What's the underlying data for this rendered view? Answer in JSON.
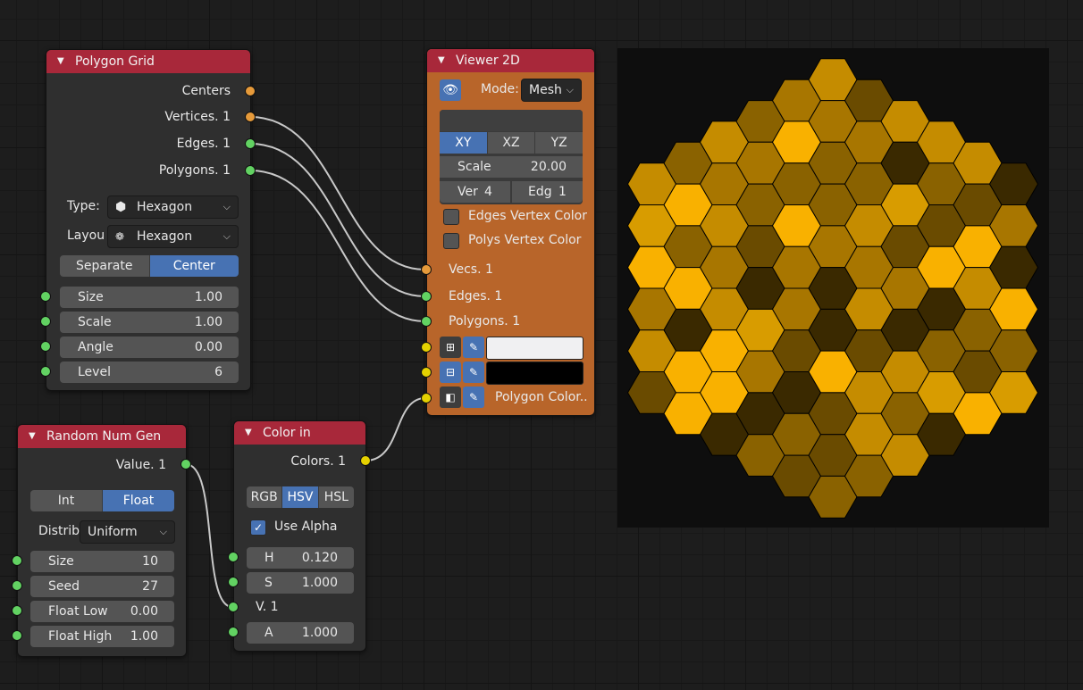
{
  "colors": {
    "node_bg": "#2f2f2f",
    "header_red": "#a8283a",
    "viewer_orange": "#b8652a",
    "accent_blue": "#4772b3",
    "socket_orange": "#e69a3a",
    "socket_green": "#62d262",
    "socket_yellow": "#e5d100",
    "wire": "#c8c8c8"
  },
  "polygon_grid": {
    "title": "Polygon Grid",
    "outputs": [
      "Centers",
      "Vertices. 1",
      "Edges. 1",
      "Polygons. 1"
    ],
    "type_label": "Type:",
    "type_value": "Hexagon",
    "type_icon": "hexagon-icon",
    "layout_label": "Layou",
    "layout_value": "Hexagon",
    "layout_icon": "hex-cluster-icon",
    "mode_buttons": [
      "Separate",
      "Center"
    ],
    "mode_active": "Center",
    "fields": [
      {
        "label": "Size",
        "value": "1.00"
      },
      {
        "label": "Scale",
        "value": "1.00"
      },
      {
        "label": "Angle",
        "value": "0.00"
      },
      {
        "label": "Level",
        "value": "6"
      }
    ]
  },
  "viewer": {
    "title": "Viewer 2D",
    "eye_icon": "eye-icon",
    "mode_label": "Mode:",
    "mode_value": "Mesh",
    "planes": [
      "XY",
      "XZ",
      "YZ"
    ],
    "plane_active": "XY",
    "scale_label": "Scale",
    "scale_value": "20.00",
    "ver_label": "Ver",
    "ver_value": "4",
    "edg_label": "Edg",
    "edg_value": "1",
    "check_edges": "Edges Vertex Color",
    "check_polys": "Polys Vertex Color",
    "inputs": [
      "Vecs. 1",
      "Edges. 1",
      "Polygons. 1"
    ],
    "color_rows": [
      {
        "swatch": "#f0f0f2",
        "text": ""
      },
      {
        "swatch": "#000000",
        "text": ""
      },
      {
        "swatch": "",
        "text": "Polygon Color.."
      }
    ]
  },
  "random": {
    "title": "Random Num Gen",
    "output": "Value. 1",
    "type_buttons": [
      "Int",
      "Float"
    ],
    "type_active": "Float",
    "distrib_label": "Distrib",
    "distrib_value": "Uniform",
    "fields": [
      {
        "label": "Size",
        "value": "10"
      },
      {
        "label": "Seed",
        "value": "27"
      },
      {
        "label": "Float Low",
        "value": "0.00"
      },
      {
        "label": "Float High",
        "value": "1.00"
      }
    ]
  },
  "color_in": {
    "title": "Color in",
    "output": "Colors. 1",
    "modes": [
      "RGB",
      "HSV",
      "HSL"
    ],
    "mode_active": "HSV",
    "use_alpha": "Use Alpha",
    "use_alpha_checked": true,
    "h_label": "H",
    "h_value": "0.120",
    "s_label": "S",
    "s_value": "1.000",
    "v_label": "V. 1",
    "a_label": "A",
    "a_value": "1.000"
  },
  "preview": {
    "background": "#0e0e0e",
    "hex_colors": [
      "#f9b100",
      "#d89c00",
      "#c58c00",
      "#a87600",
      "#8a6200",
      "#6a4b00",
      "#3a2900"
    ]
  }
}
